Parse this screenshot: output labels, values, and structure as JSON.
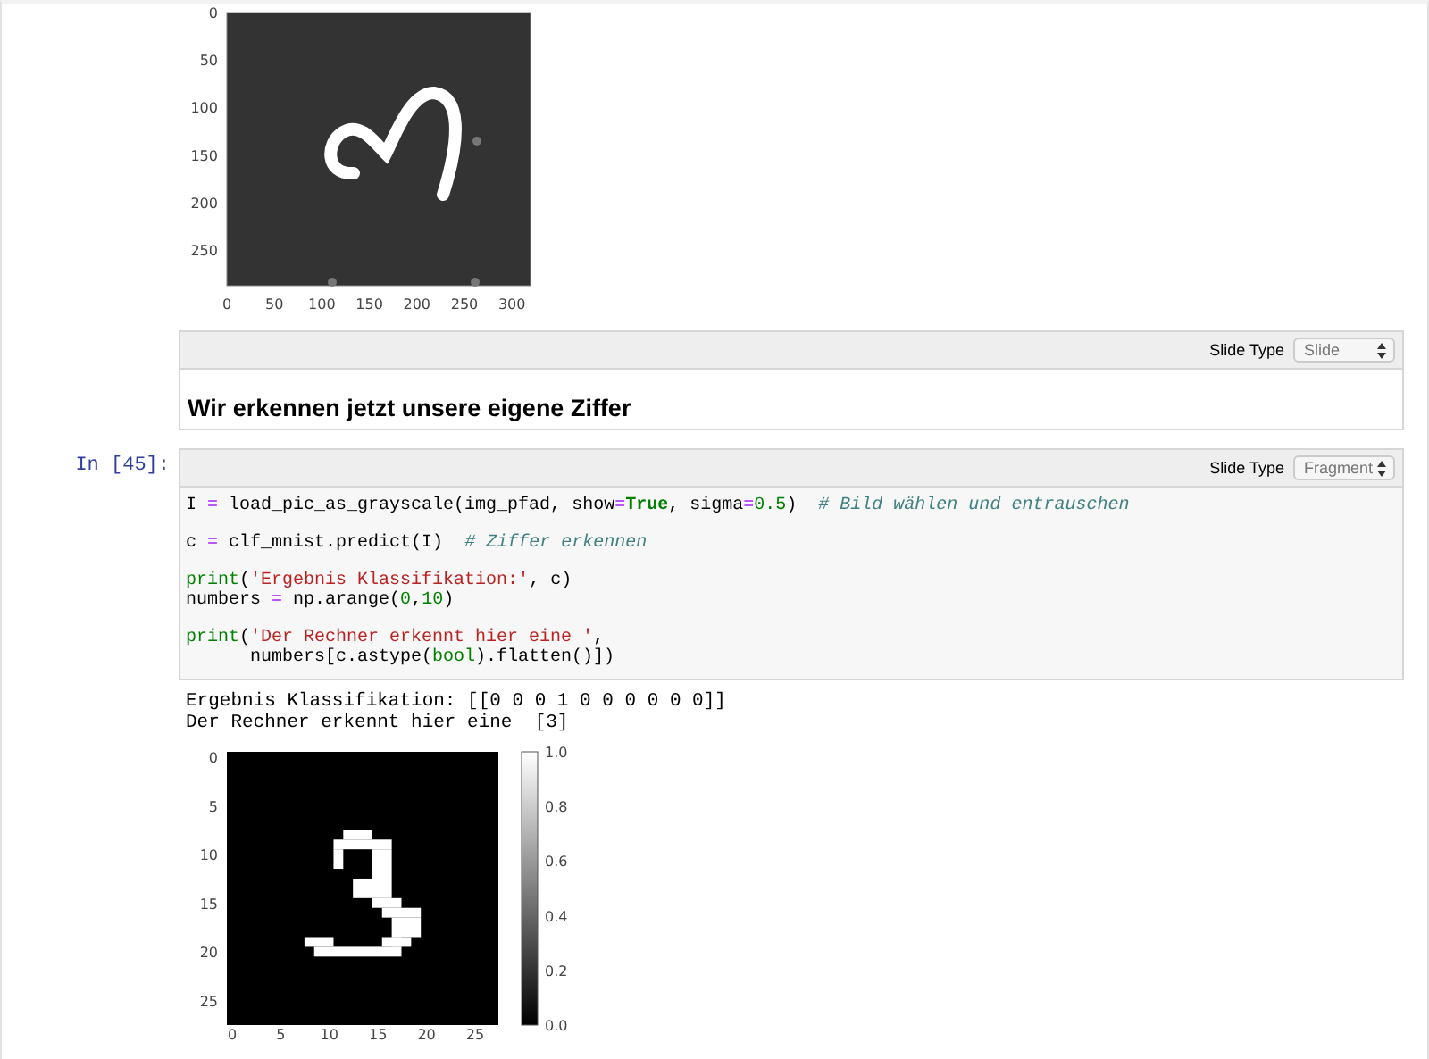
{
  "top_output": {
    "figure": {
      "y_ticks": [
        "0",
        "50",
        "100",
        "150",
        "200",
        "250"
      ],
      "x_ticks": [
        "0",
        "50",
        "100",
        "150",
        "200",
        "250",
        "300"
      ]
    }
  },
  "markdown_cell": {
    "slide_type_label": "Slide Type",
    "slide_type": "Slide",
    "heading": "Wir erkennen jetzt unsere eigene Ziffer"
  },
  "code_cell": {
    "prompt": "In [45]:",
    "slide_type_label": "Slide Type",
    "slide_type": "Fragment",
    "lines": [
      {
        "spaced": false,
        "tokens": [
          {
            "text": "I ",
            "kind": "plain"
          },
          {
            "text": "=",
            "kind": "op"
          },
          {
            "text": " load_pic_as_grayscale(img_pfad, show",
            "kind": "plain"
          },
          {
            "text": "=",
            "kind": "op"
          },
          {
            "text": "True",
            "kind": "keyword"
          },
          {
            "text": ", sigma",
            "kind": "plain"
          },
          {
            "text": "=",
            "kind": "op"
          },
          {
            "text": "0.5",
            "kind": "number"
          },
          {
            "text": ")  ",
            "kind": "plain"
          },
          {
            "text": "# Bild wählen und entrauschen",
            "kind": "comment"
          }
        ]
      },
      {
        "spaced": true,
        "tokens": [
          {
            "text": "c ",
            "kind": "plain"
          },
          {
            "text": "=",
            "kind": "op"
          },
          {
            "text": " clf_mnist.predict(I)  ",
            "kind": "plain"
          },
          {
            "text": "# Ziffer erkennen",
            "kind": "comment"
          }
        ]
      },
      {
        "spaced": true,
        "tokens": [
          {
            "text": "print",
            "kind": "builtin"
          },
          {
            "text": "(",
            "kind": "plain"
          },
          {
            "text": "'Ergebnis Klassifikation:'",
            "kind": "string"
          },
          {
            "text": ", c)",
            "kind": "plain"
          }
        ]
      },
      {
        "spaced": false,
        "tokens": [
          {
            "text": "numbers ",
            "kind": "plain"
          },
          {
            "text": "=",
            "kind": "op"
          },
          {
            "text": " np.arange(",
            "kind": "plain"
          },
          {
            "text": "0",
            "kind": "number"
          },
          {
            "text": ",",
            "kind": "plain"
          },
          {
            "text": "10",
            "kind": "number"
          },
          {
            "text": ")",
            "kind": "plain"
          }
        ]
      },
      {
        "spaced": true,
        "tokens": [
          {
            "text": "print",
            "kind": "builtin"
          },
          {
            "text": "(",
            "kind": "plain"
          },
          {
            "text": "'Der Rechner erkennt hier eine '",
            "kind": "string"
          },
          {
            "text": ",",
            "kind": "plain"
          }
        ]
      },
      {
        "spaced": false,
        "tokens": [
          {
            "text": "      numbers[c.astype(",
            "kind": "plain"
          },
          {
            "text": "bool",
            "kind": "builtin"
          },
          {
            "text": ").flatten()])",
            "kind": "plain"
          }
        ]
      }
    ],
    "output_lines": [
      "Ergebnis Klassifikation: [[0 0 0 1 0 0 0 0 0 0]]",
      "Der Rechner erkennt hier eine  [3]"
    ],
    "figure": {
      "y_ticks": [
        "0",
        "5",
        "10",
        "15",
        "20",
        "25"
      ],
      "x_ticks": [
        "0",
        "5",
        "10",
        "15",
        "20",
        "25"
      ],
      "colorbar_ticks": [
        "1.0",
        "0.8",
        "0.6",
        "0.4",
        "0.2",
        "0.0"
      ]
    }
  }
}
